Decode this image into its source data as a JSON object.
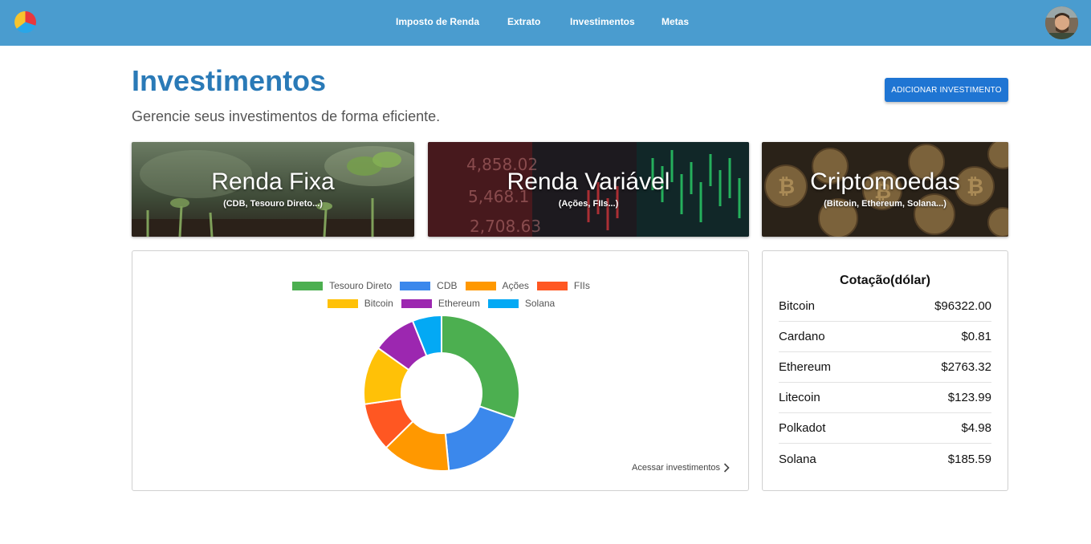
{
  "nav": {
    "items": [
      "Imposto de Renda",
      "Extrato",
      "Investimentos",
      "Metas"
    ]
  },
  "header": {
    "title": "Investimentos",
    "subtitle": "Gerencie seus investimentos de forma eficiente.",
    "add_button": "ADICIONAR INVESTIMENTO"
  },
  "categories": [
    {
      "title": "Renda Fixa",
      "subtitle": "(CDB, Tesouro Direto...)"
    },
    {
      "title": "Renda Variável",
      "subtitle": "(Ações, FIIs...)"
    },
    {
      "title": "Criptomoedas",
      "subtitle": "(Bitcoin, Ethereum, Solana...)"
    }
  ],
  "chart_data": {
    "type": "pie",
    "variant": "doughnut",
    "legend_position": "top",
    "series": [
      {
        "name": "Tesouro Direto",
        "value": 30,
        "color": "#4caf50"
      },
      {
        "name": "CDB",
        "value": 18,
        "color": "#3b88ec"
      },
      {
        "name": "Ações",
        "value": 14,
        "color": "#ff9800"
      },
      {
        "name": "FIIs",
        "value": 10,
        "color": "#ff5722"
      },
      {
        "name": "Bitcoin",
        "value": 12,
        "color": "#ffc107"
      },
      {
        "name": "Ethereum",
        "value": 9,
        "color": "#9c27b0"
      },
      {
        "name": "Solana",
        "value": 6,
        "color": "#03a9f4"
      }
    ]
  },
  "chart_panel": {
    "access_link": "Acessar investimentos"
  },
  "quotes": {
    "title": "Cotação(dólar)",
    "rows": [
      {
        "name": "Bitcoin",
        "price": "$96322.00"
      },
      {
        "name": "Cardano",
        "price": "$0.81"
      },
      {
        "name": "Ethereum",
        "price": "$2763.32"
      },
      {
        "name": "Litecoin",
        "price": "$123.99"
      },
      {
        "name": "Polkadot",
        "price": "$4.98"
      },
      {
        "name": "Solana",
        "price": "$185.59"
      }
    ]
  }
}
